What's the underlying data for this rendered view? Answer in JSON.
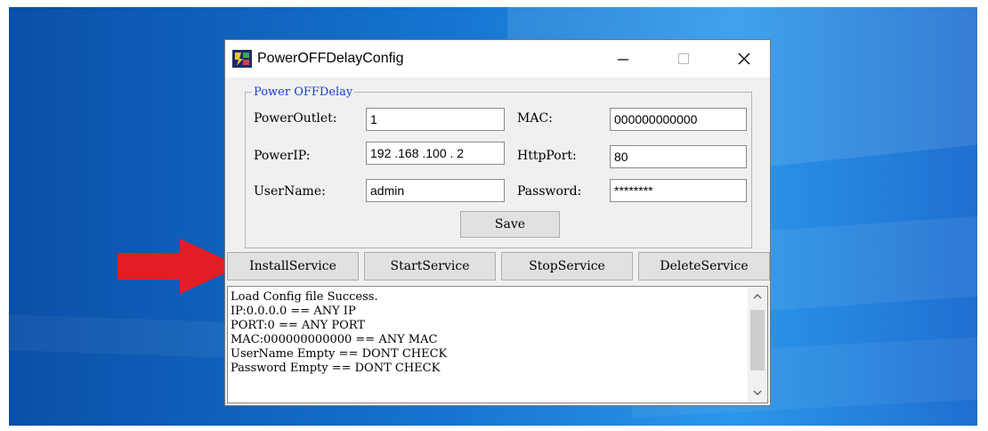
{
  "window": {
    "title": "PowerOFFDelayConfig"
  },
  "group": {
    "legend": "Power OFFDelay",
    "power_outlet": {
      "label": "PowerOutlet:",
      "value": "1"
    },
    "mac": {
      "label": "MAC:",
      "value": "000000000000"
    },
    "power_ip": {
      "label": "PowerIP:",
      "value": "192 .168 .100 . 2"
    },
    "http_port": {
      "label": "HttpPort:",
      "value": "80"
    },
    "username": {
      "label": "UserName:",
      "value": "admin"
    },
    "password": {
      "label": "Password:",
      "value": "********"
    },
    "save_label": "Save"
  },
  "services": {
    "install": "InstallService",
    "start": "StartService",
    "stop": "StopService",
    "delete": "DeleteService"
  },
  "log": {
    "lines": [
      "Load Config file Success.",
      "IP:0.0.0.0 == ANY IP",
      "PORT:0 == ANY PORT",
      "MAC:000000000000 == ANY MAC",
      "UserName Empty == DONT CHECK",
      "Password Empty == DONT CHECK"
    ]
  },
  "colors": {
    "arrow": "#e31d25",
    "legend": "#1a3cd8",
    "desktop": "#1574d0"
  }
}
